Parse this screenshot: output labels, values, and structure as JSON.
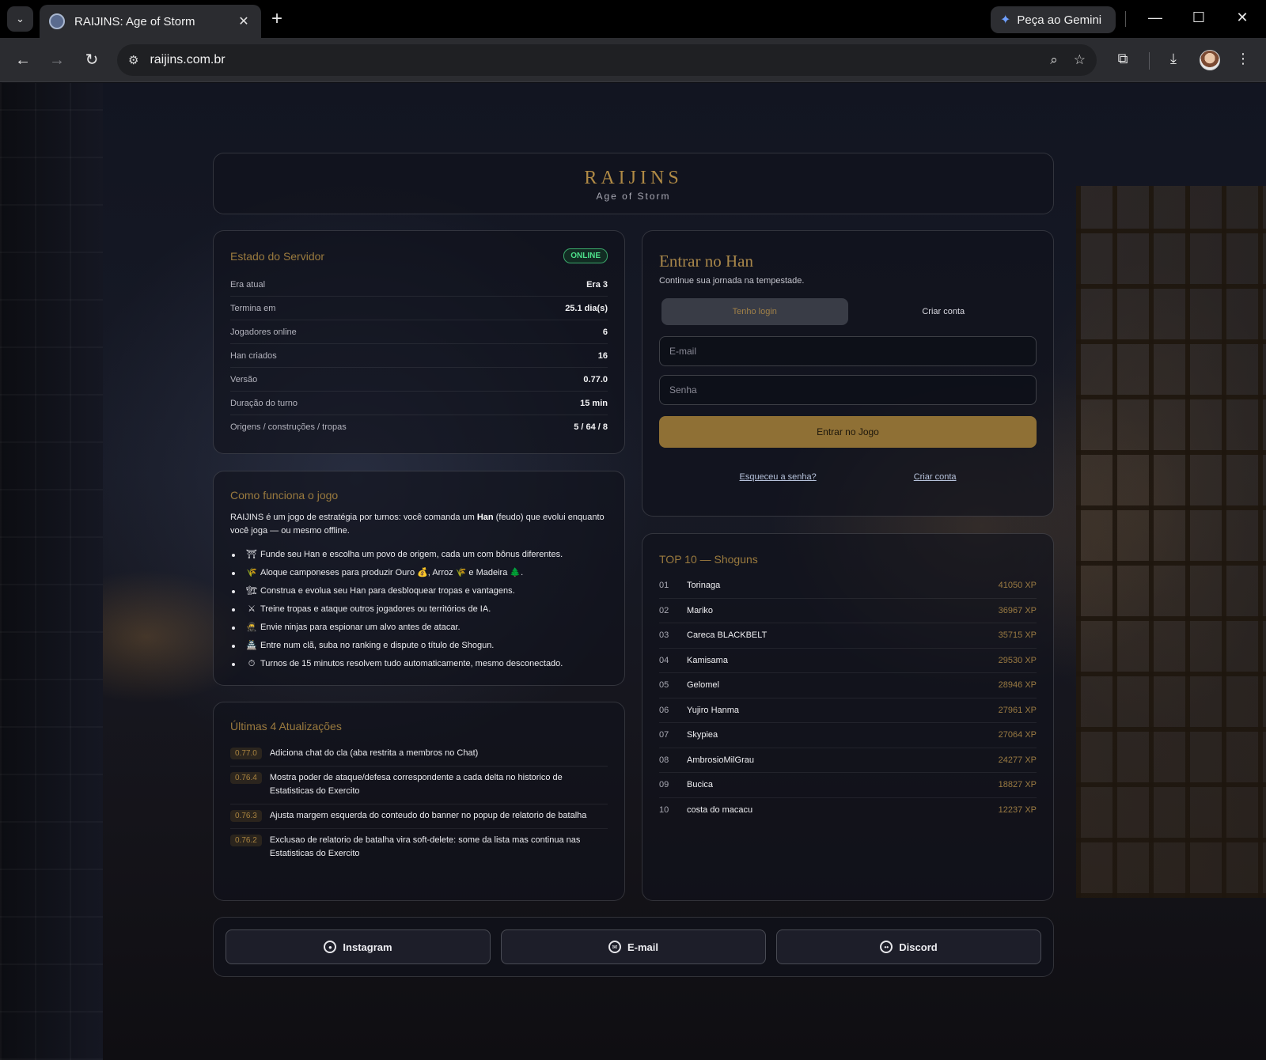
{
  "browser": {
    "tab_title": "RAIJINS: Age of Storm",
    "gemini_label": "Peça ao Gemini",
    "url": "raijins.com.br"
  },
  "header": {
    "brand": "RAIJINS",
    "subtitle": "Age of Storm"
  },
  "server": {
    "title": "Estado do Servidor",
    "status": "ONLINE",
    "rows": [
      {
        "label": "Era atual",
        "value": "Era 3"
      },
      {
        "label": "Termina em",
        "value": "25.1 dia(s)"
      },
      {
        "label": "Jogadores online",
        "value": "6"
      },
      {
        "label": "Han criados",
        "value": "16"
      },
      {
        "label": "Versão",
        "value": "0.77.0"
      },
      {
        "label": "Duração do turno",
        "value": "15 min"
      },
      {
        "label": "Origens / construções / tropas",
        "value": "5 / 64 / 8"
      }
    ]
  },
  "how": {
    "title": "Como funciona o jogo",
    "intro_a": "RAIJINS é um jogo de estratégia por turnos: você comanda um ",
    "intro_b": "Han",
    "intro_c": " (feudo) que evolui enquanto você joga — ou mesmo offline.",
    "items": [
      {
        "icon": "⛩",
        "text": "Funde seu Han e escolha um povo de origem, cada um com bônus diferentes."
      },
      {
        "icon": "🌾",
        "text": "Aloque camponeses para produzir Ouro 💰, Arroz 🌾 e Madeira 🌲."
      },
      {
        "icon": "🏗",
        "text": "Construa e evolua seu Han para desbloquear tropas e vantagens."
      },
      {
        "icon": "⚔",
        "text": "Treine tropas e ataque outros jogadores ou territórios de IA."
      },
      {
        "icon": "🥷",
        "text": "Envie ninjas para espionar um alvo antes de atacar."
      },
      {
        "icon": "🏯",
        "text": "Entre num clã, suba no ranking e dispute o título de Shogun."
      },
      {
        "icon": "⏱",
        "text": "Turnos de 15 minutos resolvem tudo automaticamente, mesmo desconectado."
      }
    ]
  },
  "updates": {
    "title": "Últimas 4 Atualizações",
    "items": [
      {
        "version": "0.77.0",
        "text": "Adiciona chat do cla (aba restrita a membros no Chat)"
      },
      {
        "version": "0.76.4",
        "text": "Mostra poder de ataque/defesa correspondente a cada delta no historico de Estatisticas do Exercito"
      },
      {
        "version": "0.76.3",
        "text": "Ajusta margem esquerda do conteudo do banner no popup de relatorio de batalha"
      },
      {
        "version": "0.76.2",
        "text": "Exclusao de relatorio de batalha vira soft-delete: some da lista mas continua nas Estatisticas do Exercito"
      }
    ]
  },
  "login": {
    "title": "Entrar no Han",
    "subtitle": "Continue sua jornada na tempestade.",
    "tab_login": "Tenho login",
    "tab_create": "Criar conta",
    "email_placeholder": "E-mail",
    "password_placeholder": "Senha",
    "submit": "Entrar no Jogo",
    "forgot": "Esqueceu a senha?",
    "create": "Criar conta"
  },
  "ranking": {
    "title": "TOP 10 — Shoguns",
    "rows": [
      {
        "pos": "01",
        "name": "Torinaga",
        "xp": "41050 XP"
      },
      {
        "pos": "02",
        "name": "Mariko",
        "xp": "36967 XP"
      },
      {
        "pos": "03",
        "name": "Careca BLACKBELT",
        "xp": "35715 XP"
      },
      {
        "pos": "04",
        "name": "Kamisama",
        "xp": "29530 XP"
      },
      {
        "pos": "05",
        "name": "Gelomel",
        "xp": "28946 XP"
      },
      {
        "pos": "06",
        "name": "Yujiro Hanma",
        "xp": "27961 XP"
      },
      {
        "pos": "07",
        "name": "Skypiea",
        "xp": "27064 XP"
      },
      {
        "pos": "08",
        "name": "AmbrosioMilGrau",
        "xp": "24277 XP"
      },
      {
        "pos": "09",
        "name": "Bucica",
        "xp": "18827 XP"
      },
      {
        "pos": "10",
        "name": "costa do macacu",
        "xp": "12237 XP"
      }
    ]
  },
  "footer": {
    "instagram": "Instagram",
    "email": "E-mail",
    "discord": "Discord"
  },
  "colors": {
    "accent_gold": "#9a7a3e",
    "online_green": "#4de08a",
    "button_gold": "#8f7035"
  }
}
